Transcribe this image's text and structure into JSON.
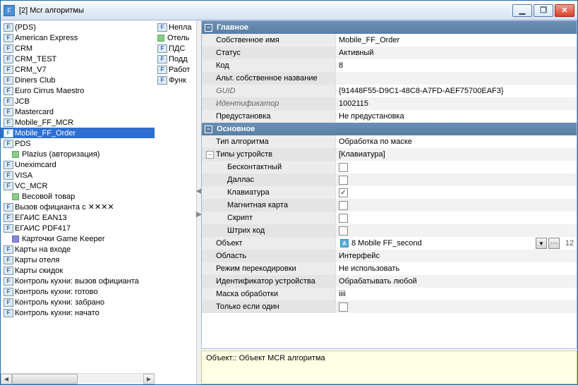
{
  "window": {
    "title": "[2] Mcr алгоритмы"
  },
  "winbtns": {
    "min": "▁",
    "max": "❐",
    "close": "✕"
  },
  "left_col1": [
    {
      "label": "(PDS)",
      "icon": "blue"
    },
    {
      "label": "American Express",
      "icon": "blue"
    },
    {
      "label": "CRM",
      "icon": "blue"
    },
    {
      "label": "CRM_TEST",
      "icon": "blue"
    },
    {
      "label": "CRM_V7",
      "icon": "blue"
    },
    {
      "label": "Diners Club",
      "icon": "blue"
    },
    {
      "label": "Euro Cirrus Maestro",
      "icon": "blue"
    },
    {
      "label": "JCB",
      "icon": "blue"
    },
    {
      "label": "Mastercard",
      "icon": "blue"
    },
    {
      "label": "Mobile_FF_MCR",
      "icon": "blue"
    },
    {
      "label": "Mobile_FF_Order",
      "icon": "blue",
      "selected": true
    },
    {
      "label": "PDS",
      "icon": "blue"
    },
    {
      "label": "Plazius (авторизация)",
      "icon": "blue",
      "indent": 1,
      "small": "sm"
    },
    {
      "label": "Uneximcard",
      "icon": "blue"
    },
    {
      "label": "VISA",
      "icon": "blue"
    },
    {
      "label": "VC_MCR",
      "icon": "blue"
    },
    {
      "label": "Весовой товар",
      "icon": "green",
      "indent": 1,
      "small": "sm"
    },
    {
      "label": "Вызов официанта с ✕✕✕✕",
      "icon": "blue"
    },
    {
      "label": "ЕГАИС EAN13",
      "icon": "blue"
    },
    {
      "label": "ЕГАИС PDF417",
      "icon": "blue"
    },
    {
      "label": "Карточки Game Keeper",
      "icon": "blue",
      "indent": 1,
      "small": "sm2"
    },
    {
      "label": "Карты на входе",
      "icon": "blue"
    },
    {
      "label": "Карты отеля",
      "icon": "blue"
    },
    {
      "label": "Карты скидок",
      "icon": "blue"
    },
    {
      "label": "Контроль кухни: вызов официанта",
      "icon": "blue"
    },
    {
      "label": "Контроль кухни: готово",
      "icon": "blue"
    },
    {
      "label": "Контроль кухни: забрано",
      "icon": "blue"
    },
    {
      "label": "Контроль кухни: начато",
      "icon": "blue"
    }
  ],
  "left_col2": [
    {
      "label": "Непла",
      "icon": "blue"
    },
    {
      "label": "Отель",
      "icon": "green",
      "small": "sm"
    },
    {
      "label": "ПДС",
      "icon": "blue"
    },
    {
      "label": "Подд",
      "icon": "blue"
    },
    {
      "label": "Работ",
      "icon": "blue"
    },
    {
      "label": "Функ",
      "icon": "blue"
    }
  ],
  "sections": {
    "main": "Главное",
    "basic": "Основное"
  },
  "props_main": [
    {
      "label": "Собственное имя",
      "value": "Mobile_FF_Order"
    },
    {
      "label": "Статус",
      "value": "Активный"
    },
    {
      "label": "Код",
      "value": "8"
    },
    {
      "label": "Альт. собственное название",
      "value": ""
    },
    {
      "label": "GUID",
      "value": "{91448F55-D9C1-48C8-A7FD-AEF75700EAF3}",
      "italic": true
    },
    {
      "label": "Идентификатор",
      "value": "1002115",
      "italic": true
    },
    {
      "label": "Предустановка",
      "value": "Не предустановка"
    }
  ],
  "props_basic": [
    {
      "label": "Тип алгоритма",
      "value": "Обработка по маске"
    },
    {
      "label": "Типы устройств",
      "value": "[Клавиатура]",
      "expander": true
    },
    {
      "label": "Бесконтактный",
      "checkbox": true,
      "checked": false,
      "indent": true
    },
    {
      "label": "Даллас",
      "checkbox": true,
      "checked": false,
      "indent": true
    },
    {
      "label": "Клавиатура",
      "checkbox": true,
      "checked": true,
      "indent": true
    },
    {
      "label": "Магнитная карта",
      "checkbox": true,
      "checked": false,
      "indent": true
    },
    {
      "label": "Скрипт",
      "checkbox": true,
      "checked": false,
      "indent": true
    },
    {
      "label": "Штрих код",
      "checkbox": true,
      "checked": false,
      "indent": true
    },
    {
      "label": "Объект",
      "value": "8 Mobile FF_second",
      "dropdown": true,
      "num": "12"
    },
    {
      "label": "Область",
      "value": "Интерфейс"
    },
    {
      "label": "Режим перекодировки",
      "value": "Не использовать"
    },
    {
      "label": "Идентификатор устройства",
      "value": "Обрабатывать любой"
    },
    {
      "label": "Маска обработки",
      "value": "iiii"
    },
    {
      "label": "Только если один",
      "checkbox": true,
      "checked": false
    }
  ],
  "status": "Объект:: Объект MCR алгоритма"
}
